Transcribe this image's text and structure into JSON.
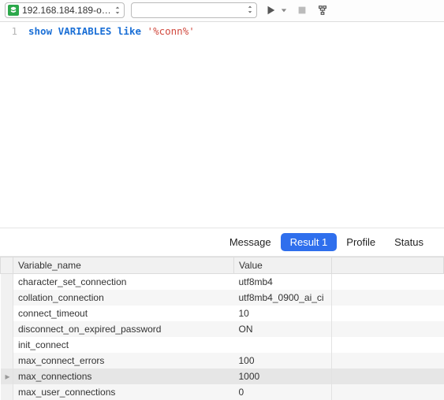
{
  "toolbar": {
    "connection_label": "192.168.184.189-o…",
    "combo_value": "",
    "run_icon": "play",
    "stop_icon": "stop",
    "explain_icon": "tree"
  },
  "editor": {
    "line_no": "1",
    "kw_show": "show",
    "kw_variables": "VARIABLES",
    "kw_like": "like",
    "str_pattern": "'%conn%'"
  },
  "tabs": {
    "message": "Message",
    "result1": "Result 1",
    "profile": "Profile",
    "status": "Status"
  },
  "columns": {
    "variable": "Variable_name",
    "value": "Value"
  },
  "rows": [
    {
      "k": "character_set_connection",
      "v": "utf8mb4"
    },
    {
      "k": "collation_connection",
      "v": "utf8mb4_0900_ai_ci"
    },
    {
      "k": "connect_timeout",
      "v": "10"
    },
    {
      "k": "disconnect_on_expired_password",
      "v": "ON"
    },
    {
      "k": "init_connect",
      "v": ""
    },
    {
      "k": "max_connect_errors",
      "v": "100"
    },
    {
      "k": "max_connections",
      "v": "1000"
    },
    {
      "k": "max_user_connections",
      "v": "0"
    }
  ],
  "selected_row_index": 6
}
